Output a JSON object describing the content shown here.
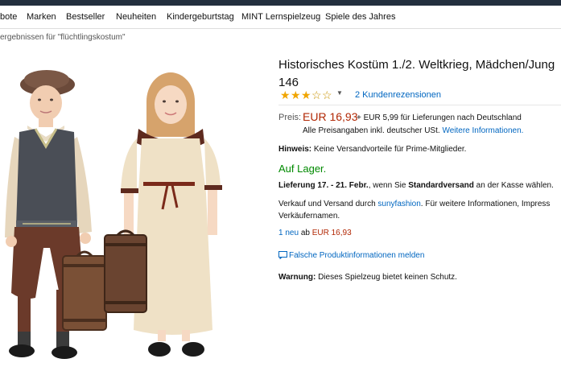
{
  "nav": {
    "items": [
      "bote",
      "Marken",
      "Bestseller",
      "Neuheiten",
      "Kindergeburtstag",
      "MINT Lernspielzeug",
      "Spiele des Jahres"
    ]
  },
  "breadcrumb": "ergebnissen für \"flüchtlingskostum\"",
  "product": {
    "title_line1": "Historisches Kostüm 1./2. Weltkrieg, Mädchen/Jung",
    "title_line2": "146",
    "rating": 3,
    "rating_max": 5,
    "reviews_link": "2 Kundenrezensionen",
    "price_label": "Preis:",
    "price": "EUR 16,93",
    "shipping": "+ EUR 5,99 für Lieferungen nach Deutschland",
    "vat_text": "Alle Preisangaben inkl. deutscher USt.",
    "vat_link": "Weitere Informationen.",
    "hinweis_label": "Hinweis:",
    "hinweis_text": "Keine Versandvorteile für Prime-Mitglieder.",
    "stock": "Auf Lager.",
    "delivery_label": "Lieferung 17. - 21. Febr.",
    "delivery_mid": ", wenn Sie",
    "delivery_method": "Standardversand",
    "delivery_end": "an der Kasse wählen.",
    "seller_pre": "Verkauf und Versand durch",
    "seller_name": "sunyfashion",
    "seller_post": ". Für weitere Informationen, Impress",
    "seller_line2": "Verkäufernamen.",
    "offers_link": "1 neu",
    "offers_mid": "ab",
    "offers_price": "EUR 16,93",
    "report_link": "Falsche Produktinformationen melden",
    "warning_label": "Warnung:",
    "warning_text": "Dieses Spielzeug bietet keinen Schutz."
  },
  "colors": {
    "accent_link": "#0066c0",
    "price": "#b12704",
    "in_stock": "#008a00",
    "topbar": "#232f3e"
  }
}
